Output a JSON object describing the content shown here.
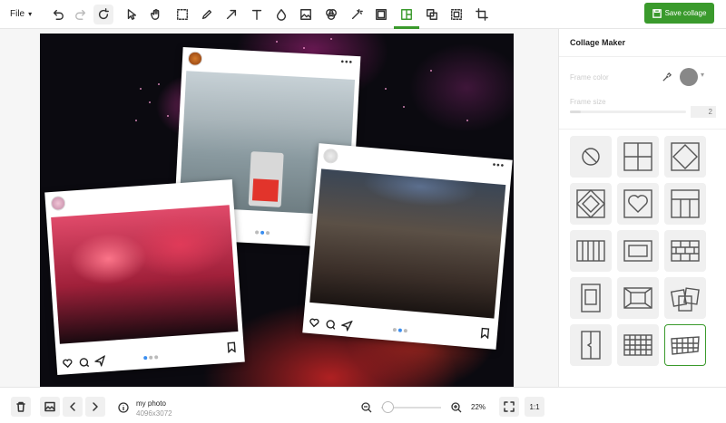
{
  "toolbar": {
    "file_label": "File",
    "save_label": "Save collage",
    "accent": "#3a9a2c"
  },
  "panel": {
    "title": "Collage Maker",
    "frame_color_label": "Frame color",
    "frame_size_label": "Frame size",
    "frame_size_value": "2",
    "frame_color": "#888888"
  },
  "layouts": [
    {
      "name": "no-frame"
    },
    {
      "name": "grid-2x2"
    },
    {
      "name": "diamond"
    },
    {
      "name": "diamond-in-grid"
    },
    {
      "name": "heart"
    },
    {
      "name": "three-columns-top-bar"
    },
    {
      "name": "vertical-stripes"
    },
    {
      "name": "film-strip"
    },
    {
      "name": "brick"
    },
    {
      "name": "window-frame"
    },
    {
      "name": "inset-frame"
    },
    {
      "name": "polaroids"
    },
    {
      "name": "vertical-split-torn"
    },
    {
      "name": "checkered"
    },
    {
      "name": "checkered-torn",
      "selected": true
    }
  ],
  "canvas": {
    "file_name": "my photo",
    "file_dims": "4096x3072",
    "zoom_label": "22%",
    "zoom_fraction": 0.1,
    "one_to_one_label": "1:1"
  }
}
